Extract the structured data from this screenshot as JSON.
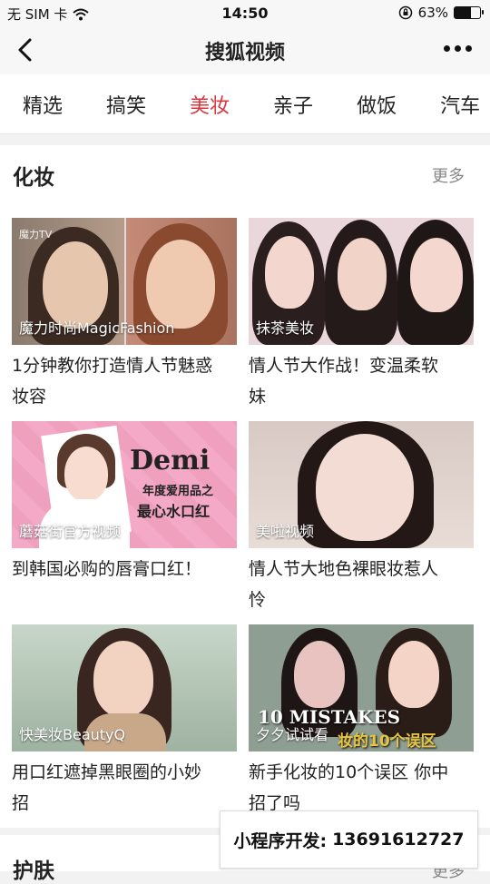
{
  "status": {
    "carrier": "无 SIM 卡",
    "time": "14:50",
    "battery": "63%",
    "battery_level": 0.63
  },
  "nav": {
    "title": "搜狐视频"
  },
  "tabs": [
    "精选",
    "搞笑",
    "美妆",
    "亲子",
    "做饭",
    "汽车"
  ],
  "active_tab": 2,
  "section": {
    "title": "化妆",
    "more": "更多"
  },
  "cards": [
    {
      "caption": "魔力时尚MagicFashion",
      "watermark": "魔力TV",
      "title_lines": [
        "1分钟教你打造情人节魅惑",
        "妆容"
      ]
    },
    {
      "caption": "抹茶美妆",
      "watermark": "",
      "title_lines": [
        "情人节大作战！变温柔软",
        "妹"
      ]
    },
    {
      "caption": "蘑菇街官方视频",
      "watermark": "",
      "overlay_name": "Demi",
      "overlay_sub1": "年度爱用品之",
      "overlay_sub2": "最心水口红",
      "title_lines": [
        "到韩国必购的唇膏口红！",
        ""
      ]
    },
    {
      "caption": "美啦视频",
      "watermark": "",
      "title_lines": [
        "情人节大地色裸眼妆惹人",
        "怜"
      ]
    },
    {
      "caption": "快美妆BeautyQ",
      "watermark": "",
      "title_lines": [
        "用口红遮掉黑眼圈的小妙",
        "招"
      ]
    },
    {
      "caption": "夕夕试试看",
      "watermark": "",
      "overlay_name": "10 MISTAKES",
      "overlay_sub1": "妆的10个误区",
      "title_lines": [
        "新手化妆的10个误区 你中",
        "招了吗"
      ]
    }
  ],
  "bottom_section": {
    "title": "护肤",
    "more": "更多"
  },
  "ad": {
    "label": "小程序开发:",
    "phone": "13691612727"
  }
}
